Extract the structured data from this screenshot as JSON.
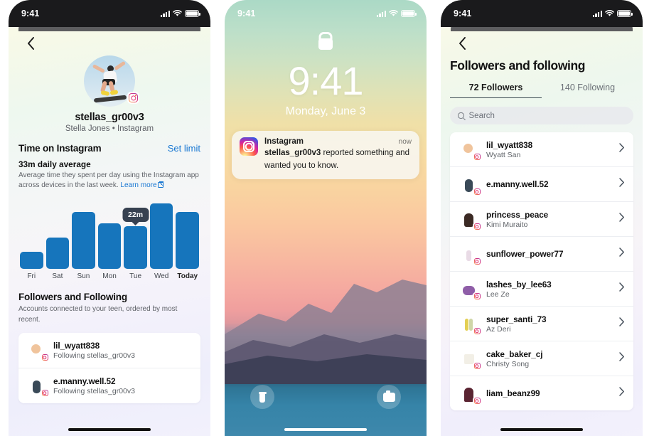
{
  "statusbar": {
    "time": "9:41",
    "signal_icon": "cellular-bars-icon",
    "wifi_icon": "wifi-icon",
    "battery_icon": "battery-icon"
  },
  "panel1": {
    "back_icon": "back-chevron-icon",
    "avatar_icon": "profile-avatar-skateboarder",
    "platform_badge": "instagram-badge-icon",
    "username": "stellas_gr00v3",
    "subline": "Stella Jones • Instagram",
    "time_section": {
      "title": "Time on Instagram",
      "action_label": "Set limit",
      "headline": "33m daily average",
      "description": "Average time they spent per day using the Instagram app across devices in the last week.",
      "learn_more": "Learn more",
      "external_icon": "external-link-icon"
    },
    "followers_section": {
      "title": "Followers and Following",
      "description": "Accounts connected to your teen, ordered by most recent."
    },
    "rows": [
      {
        "name": "lil_wyatt838",
        "sub": "Following stellas_gr00v3",
        "avatar": "a1"
      },
      {
        "name": "e.manny.well.52",
        "sub": "Following stellas_gr00v3",
        "avatar": "a2"
      }
    ]
  },
  "chart_data": {
    "type": "bar",
    "title": "Time on Instagram",
    "categories": [
      "Fri",
      "Sat",
      "Sun",
      "Mon",
      "Tue",
      "Wed",
      "Today"
    ],
    "values": [
      6,
      11,
      20,
      16,
      15,
      23,
      20
    ],
    "value_unit": "m",
    "highlight_category": "Tue",
    "highlight_label": "22m",
    "xlabel": "",
    "ylabel": "",
    "ylim": [
      0,
      25
    ],
    "grid": false,
    "legend": "none",
    "bar_color": "#1675bc",
    "tooltip_bg": "#374151"
  },
  "panel2": {
    "lock_icon": "lock-icon",
    "time": "9:41",
    "date": "Monday, June 3",
    "notification": {
      "app_icon": "instagram-app-icon",
      "app": "Instagram",
      "when": "now",
      "body_bold": "stellas_gr00v3",
      "body_rest": " reported something and wanted you to know."
    },
    "flashlight_icon": "flashlight-icon",
    "camera_icon": "camera-icon",
    "home_indicator": "home-indicator"
  },
  "panel3": {
    "back_icon": "back-chevron-icon",
    "title": "Followers and following",
    "tabs": [
      {
        "label": "72 Followers",
        "active": true
      },
      {
        "label": "140 Following",
        "active": false
      }
    ],
    "search": {
      "icon": "search-icon",
      "placeholder": "Search",
      "value": ""
    },
    "chevron_icon": "chevron-right-icon",
    "rows": [
      {
        "name": "lil_wyatt838",
        "sub": "Wyatt San",
        "avatar": "a1"
      },
      {
        "name": "e.manny.well.52",
        "sub": "",
        "avatar": "a2"
      },
      {
        "name": "princess_peace",
        "sub": "Kimi Muraito",
        "avatar": "a3"
      },
      {
        "name": "sunflower_power77",
        "sub": "",
        "avatar": "a4"
      },
      {
        "name": "lashes_by_lee63",
        "sub": "Lee Ze",
        "avatar": "a5"
      },
      {
        "name": "super_santi_73",
        "sub": "Az Deri",
        "avatar": "a6"
      },
      {
        "name": "cake_baker_cj",
        "sub": "Christy Song",
        "avatar": "a7"
      },
      {
        "name": "liam_beanz99",
        "sub": "",
        "avatar": "a8"
      }
    ]
  },
  "colors": {
    "accent_blue": "#1675bc",
    "link_blue": "#1877d2",
    "tooltip": "#374151",
    "card": "#ffffff"
  }
}
